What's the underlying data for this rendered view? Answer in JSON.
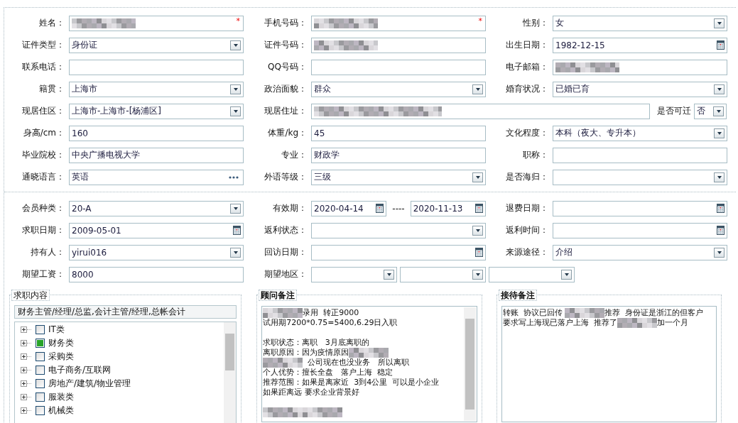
{
  "personal": {
    "rows": [
      [
        {
          "label": "姓名：",
          "kind": "text",
          "redacted": true,
          "mark": "*"
        },
        {
          "label": "手机号码：",
          "kind": "text",
          "redacted": true,
          "mark": "*"
        },
        {
          "label": "性别：",
          "kind": "select",
          "value": "女"
        }
      ],
      [
        {
          "label": "证件类型：",
          "kind": "select",
          "value": "身份证"
        },
        {
          "label": "证件号码：",
          "kind": "text",
          "redacted": true
        },
        {
          "label": "出生日期：",
          "kind": "date",
          "value": "1982-12-15"
        }
      ],
      [
        {
          "label": "联系电话：",
          "kind": "text"
        },
        {
          "label": "QQ号码：",
          "kind": "text"
        },
        {
          "label": "电子邮箱：",
          "kind": "text",
          "redacted": true
        }
      ],
      [
        {
          "label": "籍贯：",
          "kind": "select",
          "value": "上海市"
        },
        {
          "label": "政治面貌：",
          "kind": "select",
          "value": "群众"
        },
        {
          "label": "婚育状况：",
          "kind": "select",
          "value": "已婚已育"
        }
      ],
      [
        {
          "label": "现居住区：",
          "kind": "select",
          "value": "上海市-上海市-[杨浦区]"
        },
        {
          "label": "现居住址：",
          "kind": "text",
          "redacted": true
        },
        {
          "label": "是否可迁",
          "kind": "select",
          "value": "否"
        }
      ],
      [
        {
          "label": "身高/cm：",
          "kind": "text",
          "value": "160"
        },
        {
          "label": "体重/kg：",
          "kind": "text",
          "value": "45"
        },
        {
          "label": "文化程度：",
          "kind": "select",
          "value": "本科（夜大、专升本）"
        }
      ],
      [
        {
          "label": "毕业院校：",
          "kind": "text",
          "value": "中央广播电视大学"
        },
        {
          "label": "专业：",
          "kind": "text",
          "value": "财政学"
        },
        {
          "label": "职称：",
          "kind": "text"
        }
      ],
      [
        {
          "label": "通晓语言：",
          "kind": "picker",
          "value": "英语"
        },
        {
          "label": "外语等级：",
          "kind": "select",
          "value": "三级"
        },
        {
          "label": "是否海归：",
          "kind": "select"
        }
      ]
    ]
  },
  "membership": {
    "rows": [
      [
        {
          "label": "会员种类：",
          "kind": "select",
          "value": "20-A"
        },
        {
          "label": "有效期：",
          "kind": "date_range",
          "from": "2020-04-14",
          "separator": "----",
          "to": "2020-11-13"
        },
        {
          "label": "退费日期：",
          "kind": "date"
        }
      ],
      [
        {
          "label": "求职日期：",
          "kind": "date",
          "value": "2009-05-01"
        },
        {
          "label": "返利状态：",
          "kind": "select"
        },
        {
          "label": "返利时间：",
          "kind": "date"
        }
      ],
      [
        {
          "label": "持有人：",
          "kind": "select",
          "value": "yirui016"
        },
        {
          "label": "回访日期：",
          "kind": "date"
        },
        {
          "label": "来源途径：",
          "kind": "select",
          "value": "介绍"
        }
      ],
      [
        {
          "label": "期望工资：",
          "kind": "text",
          "value": "8000"
        },
        {
          "label": "期望地区：",
          "kind": "region_select"
        }
      ]
    ]
  },
  "panels": [
    {
      "kind": "tree",
      "title": "求职内容",
      "summary": "财务主管/经理/总监,会计主管/经理,总帐会计",
      "items": [
        {
          "label": "IT类",
          "checked": false
        },
        {
          "label": "财务类",
          "checked": true
        },
        {
          "label": "采购类",
          "checked": false
        },
        {
          "label": "电子商务/互联网",
          "checked": false
        },
        {
          "label": "房地产/建筑/物业管理",
          "checked": false
        },
        {
          "label": "服装类",
          "checked": false
        },
        {
          "label": "机械类",
          "checked": false
        }
      ]
    },
    {
      "kind": "notes",
      "title": "顾问备注",
      "paragraphs": [
        [
          [
            {
              "kind": "redacted"
            },
            {
              "kind": "text",
              "text": "录用  转正9000"
            }
          ],
          [
            {
              "kind": "text",
              "text": "试用期7200*0.75=5400,6.29日入职"
            }
          ]
        ],
        [
          [
            {
              "kind": "text",
              "text": "求职状态：离职   3月底离职的"
            }
          ],
          [
            {
              "kind": "text",
              "text": "离职原因：因为疫情原因"
            },
            {
              "kind": "redacted"
            }
          ],
          [
            {
              "kind": "redacted"
            },
            {
              "kind": "text",
              "text": "  公司现在也没业务   所以离职"
            }
          ],
          [
            {
              "kind": "text",
              "text": "个人优势：擅长全盘   落户上海  稳定"
            }
          ],
          [
            {
              "kind": "text",
              "text": "推荐范围：如果是离家近  3到4公里  可以是小企业"
            }
          ],
          [
            {
              "kind": "text",
              "text": "如果距离远 要求企业背景好"
            }
          ]
        ],
        [
          [
            {
              "kind": "redacted"
            },
            {
              "kind": "redacted"
            }
          ]
        ]
      ]
    },
    {
      "kind": "notes",
      "title": "接待备注",
      "paragraphs": [
        [
          [
            {
              "kind": "text",
              "text": "转账  协议已回传 "
            },
            {
              "kind": "redacted"
            },
            {
              "kind": "text",
              "text": "推荐  身份证是浙江的但客户"
            }
          ],
          [
            {
              "kind": "text",
              "text": "要求写上海现已落户上海  推荐了"
            },
            {
              "kind": "redacted"
            },
            {
              "kind": "text",
              "text": "加一个月"
            }
          ]
        ]
      ]
    }
  ]
}
